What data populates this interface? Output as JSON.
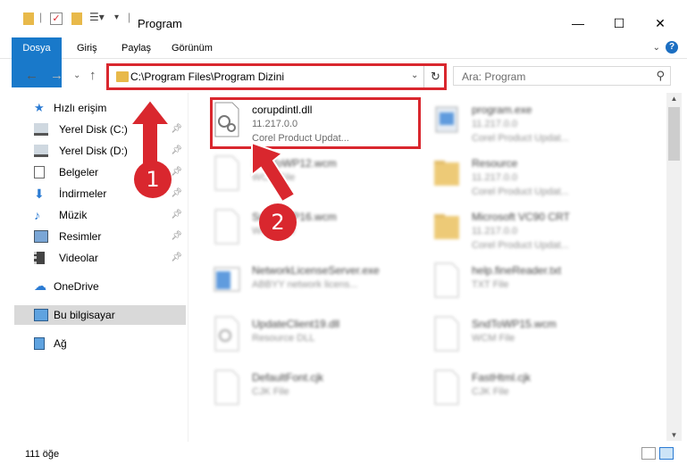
{
  "window": {
    "title": "Program",
    "minimize": "—",
    "maximize": "☐",
    "close": "✕"
  },
  "ribbon": {
    "tabs": [
      "Dosya",
      "Giriş",
      "Paylaş",
      "Görünüm"
    ],
    "expand": "⌄",
    "help": "?"
  },
  "address": {
    "path": "C:\\Program Files\\Program Dizini",
    "search_placeholder": "Ara: Program"
  },
  "sidebar": {
    "quick_access": "Hızlı erişim",
    "items": [
      {
        "label": "Yerel Disk (C:)",
        "icon": "drive-icon"
      },
      {
        "label": "Yerel Disk (D:)",
        "icon": "drive-icon"
      },
      {
        "label": "Belgeler",
        "icon": "documents-icon"
      },
      {
        "label": "İndirmeler",
        "icon": "downloads-icon"
      },
      {
        "label": "Müzik",
        "icon": "music-icon"
      },
      {
        "label": "Resimler",
        "icon": "pictures-icon"
      },
      {
        "label": "Videolar",
        "icon": "videos-icon"
      }
    ],
    "onedrive": "OneDrive",
    "this_pc": "Bu bilgisayar",
    "network": "Ağ"
  },
  "files": {
    "left": [
      {
        "name": "corupdintl.dll",
        "line1": "11.217.0.0",
        "line2": "Corel Product Updat..."
      },
      {
        "name": "SndToWP12.wcm",
        "line1": "WCM File",
        "line2": ""
      },
      {
        "name": "SndToWP16.wcm",
        "line1": "WCM File",
        "line2": ""
      },
      {
        "name": "NetworkLicenseServer.exe",
        "line1": "ABBYY network licens...",
        "line2": ""
      },
      {
        "name": "UpdateClient19.dll",
        "line1": "Resource DLL",
        "line2": ""
      },
      {
        "name": "DefaultFont.cjk",
        "line1": "CJK File",
        "line2": ""
      }
    ],
    "right": [
      {
        "name": "program.exe",
        "line1": "11.217.0.0",
        "line2": "Corel Product Updat..."
      },
      {
        "name": "Resource",
        "line1": "11.217.0.0",
        "line2": "Corel Product Updat..."
      },
      {
        "name": "Microsoft VC90 CRT",
        "line1": "11.217.0.0",
        "line2": "Corel Product Updat..."
      },
      {
        "name": "help.fineReader.txt",
        "line1": "TXT File",
        "line2": ""
      },
      {
        "name": "SndToWP15.wcm",
        "line1": "WCM File",
        "line2": ""
      },
      {
        "name": "FastHtml.cjk",
        "line1": "CJK File",
        "line2": ""
      }
    ]
  },
  "status": {
    "count": "111 öğe"
  },
  "annotations": {
    "step1": "1",
    "step2": "2"
  },
  "colors": {
    "accent": "#1979ca",
    "annotation": "#d9272e"
  }
}
